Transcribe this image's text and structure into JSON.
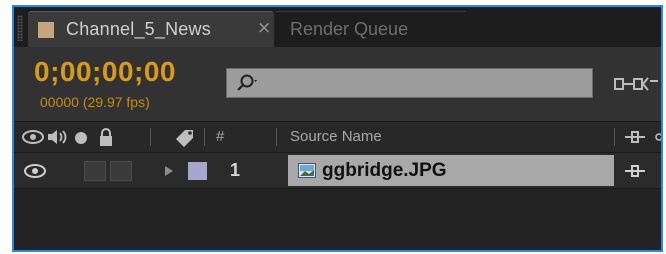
{
  "tabs": [
    {
      "label": "Channel_5_News",
      "active": true,
      "swatch_color": "#c4a77d"
    },
    {
      "label": "Render Queue",
      "active": false
    }
  ],
  "close_glyph": "×",
  "timecode": "0;00;00;00",
  "frame_info": "00000 (29.97 fps)",
  "search": {
    "value": "",
    "placeholder": ""
  },
  "columns": {
    "number": "#",
    "source_name": "Source Name"
  },
  "layers": [
    {
      "number": "1",
      "source_name": "ggbridge.JPG",
      "label_color": "#a6a6ce",
      "icon": "image-file-icon"
    }
  ],
  "colors": {
    "accent_timecode": "#d89a1b",
    "selection_border": "#2b8ad6"
  }
}
